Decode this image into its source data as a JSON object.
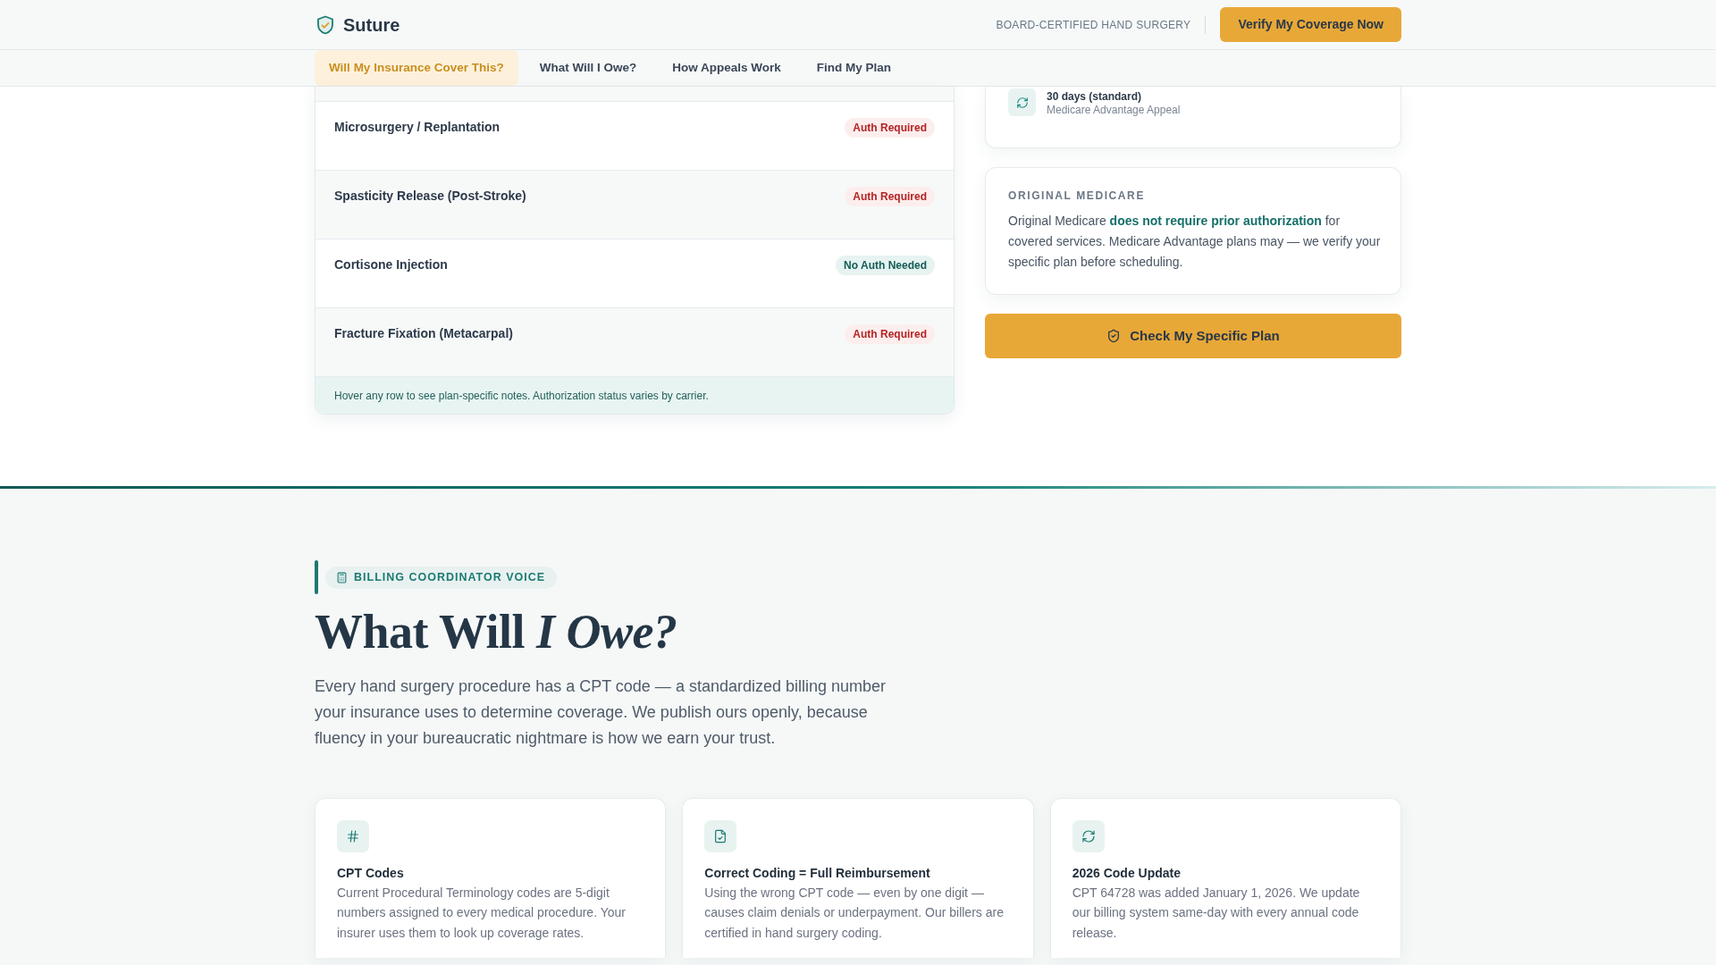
{
  "header": {
    "brand": "Suture",
    "tagline": "BOARD-CERTIFIED HAND SURGERY",
    "cta": "Verify My Coverage Now"
  },
  "nav": {
    "tabs": [
      {
        "label": "Will My Insurance Cover This?",
        "selected": true
      },
      {
        "label": "What Will I Owe?",
        "selected": false
      },
      {
        "label": "How Appeals Work",
        "selected": false
      },
      {
        "label": "Find My Plan",
        "selected": false
      }
    ]
  },
  "coverage_table": {
    "rows": [
      {
        "procedure": "Microsurgery / Replantation",
        "status": "Auth Required",
        "auth_required": true
      },
      {
        "procedure": "Spasticity Release (Post-Stroke)",
        "status": "Auth Required",
        "auth_required": true
      },
      {
        "procedure": "Cortisone Injection",
        "status": "No Auth Needed",
        "auth_required": false
      },
      {
        "procedure": "Fracture Fixation (Metacarpal)",
        "status": "Auth Required",
        "auth_required": true
      }
    ],
    "note": "Hover any row to see plan-specific notes. Authorization status varies by carrier."
  },
  "appeal_timeline": {
    "items": [
      {
        "duration": "30 days (standard)",
        "label": "Medicare Advantage Appeal"
      }
    ]
  },
  "original_medicare": {
    "title": "ORIGINAL MEDICARE",
    "text": "Original Medicare **does not require prior authorization** for covered services. Medicare Advantage plans may — we verify your specific plan before scheduling."
  },
  "check_plan_button": "Check My Specific Plan",
  "billing_section": {
    "eyebrow": "BILLING COORDINATOR VOICE",
    "heading": "What Will *I Owe?*",
    "intro": "Every hand surgery procedure has a CPT code — a standardized billing number your insurance uses to determine coverage. We publish ours openly, because fluency in your bureaucratic nightmare is how we earn your trust.",
    "cards": [
      {
        "title": "CPT Codes",
        "text": "Current Procedural Terminology codes are 5-digit numbers assigned to every medical procedure. Your insurer uses them to look up coverage rates."
      },
      {
        "title": "Correct Coding = Full Reimbursement",
        "text": "Using the wrong CPT code — even by one digit — causes claim denials or underpayment. Our billers are certified in hand surgery coding."
      },
      {
        "title": "2026 Code Update",
        "text": "CPT 64728 was added January 1, 2026. We update our billing system same-day with every annual code release."
      }
    ]
  }
}
